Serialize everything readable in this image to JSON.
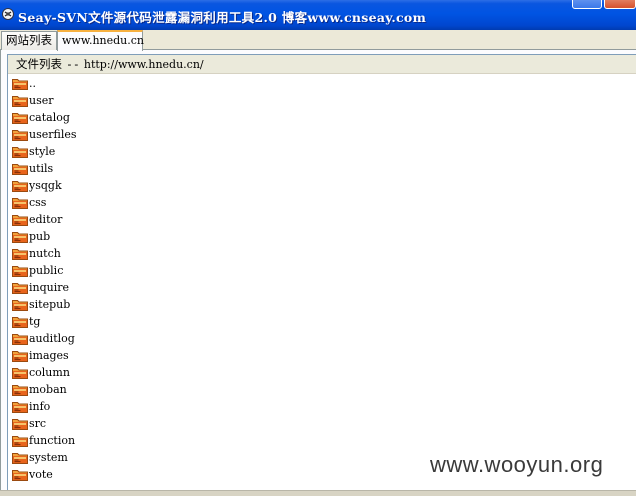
{
  "window": {
    "title": "Seay-SVN文件源代码泄露漏洞利用工具2.0  博客www.cnseay.com"
  },
  "tabs": [
    {
      "label": "网站列表",
      "active": false
    },
    {
      "label": "www.hnedu.cn",
      "active": true
    }
  ],
  "file_list": {
    "header_prefix": "文件列表",
    "header_separator": "--",
    "header_url": "http://www.hnedu.cn/",
    "items": [
      "..",
      "user",
      "catalog",
      "userfiles",
      "style",
      "utils",
      "ysqgk",
      "css",
      "editor",
      "pub",
      "nutch",
      "public",
      "inquire",
      "sitepub",
      "tg",
      "auditlog",
      "images",
      "column",
      "moban",
      "info",
      "src",
      "function",
      "system",
      "vote"
    ]
  },
  "watermark": "www.wooyun.org",
  "icons": {
    "app": "seay-app-icon",
    "folder": "folder-icon"
  },
  "colors": {
    "titlebar": "#0054e3",
    "active_tab_accent": "#f7b140",
    "folder_icon": "#e8641c"
  }
}
